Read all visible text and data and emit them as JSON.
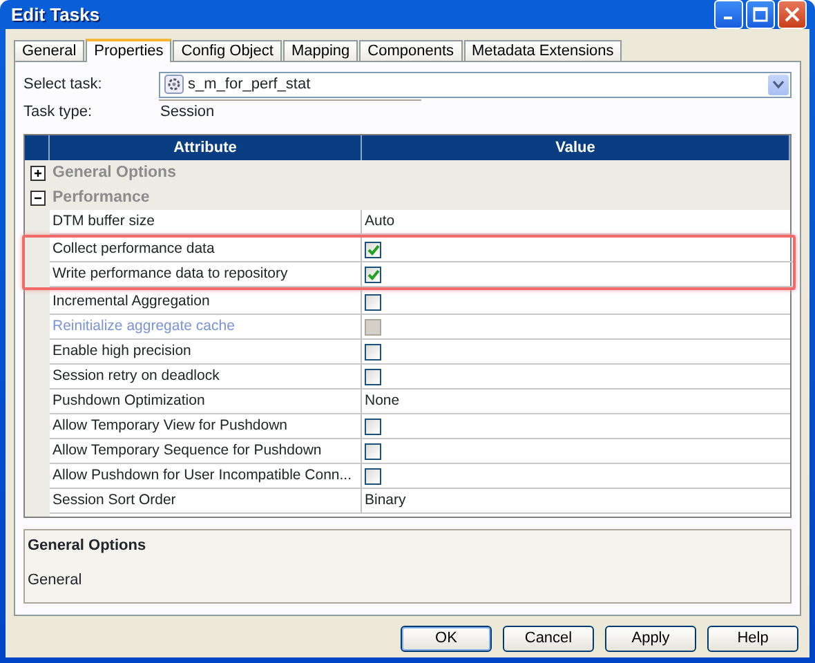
{
  "window": {
    "title": "Edit Tasks"
  },
  "tabs": [
    {
      "label": "General",
      "selected": false
    },
    {
      "label": "Properties",
      "selected": true
    },
    {
      "label": "Config Object",
      "selected": false
    },
    {
      "label": "Mapping",
      "selected": false
    },
    {
      "label": "Components",
      "selected": false
    },
    {
      "label": "Metadata Extensions",
      "selected": false
    }
  ],
  "select_task": {
    "label": "Select task:",
    "value": "s_m_for_perf_stat"
  },
  "task_type": {
    "label": "Task type:",
    "value": "Session"
  },
  "table": {
    "columns": [
      "Attribute",
      "Value"
    ],
    "groups": [
      {
        "name": "General Options",
        "expanded": false
      },
      {
        "name": "Performance",
        "expanded": true,
        "rows": [
          {
            "attribute": "DTM buffer size",
            "kind": "text",
            "value": "Auto"
          },
          {
            "attribute": "Collect performance data",
            "kind": "checkbox",
            "checked": true,
            "disabled": false,
            "highlighted": true
          },
          {
            "attribute": "Write performance data to repository",
            "kind": "checkbox",
            "checked": true,
            "disabled": false,
            "highlighted": true
          },
          {
            "attribute": "Incremental Aggregation",
            "kind": "checkbox",
            "checked": false,
            "disabled": false
          },
          {
            "attribute": "Reinitialize aggregate cache",
            "kind": "checkbox",
            "checked": false,
            "disabled": true
          },
          {
            "attribute": "Enable high precision",
            "kind": "checkbox",
            "checked": false,
            "disabled": false
          },
          {
            "attribute": "Session retry on deadlock",
            "kind": "checkbox",
            "checked": false,
            "disabled": false
          },
          {
            "attribute": "Pushdown Optimization",
            "kind": "text",
            "value": "None"
          },
          {
            "attribute": "Allow Temporary View for Pushdown",
            "kind": "checkbox",
            "checked": false,
            "disabled": false
          },
          {
            "attribute": "Allow Temporary Sequence for Pushdown",
            "kind": "checkbox",
            "checked": false,
            "disabled": false
          },
          {
            "attribute": "Allow Pushdown for User Incompatible Conn...",
            "kind": "checkbox",
            "checked": false,
            "disabled": false
          },
          {
            "attribute": "Session Sort Order",
            "kind": "text",
            "value": "Binary"
          }
        ]
      }
    ]
  },
  "description": {
    "title": "General Options",
    "text": "General"
  },
  "buttons": [
    "OK",
    "Cancel",
    "Apply",
    "Help"
  ]
}
